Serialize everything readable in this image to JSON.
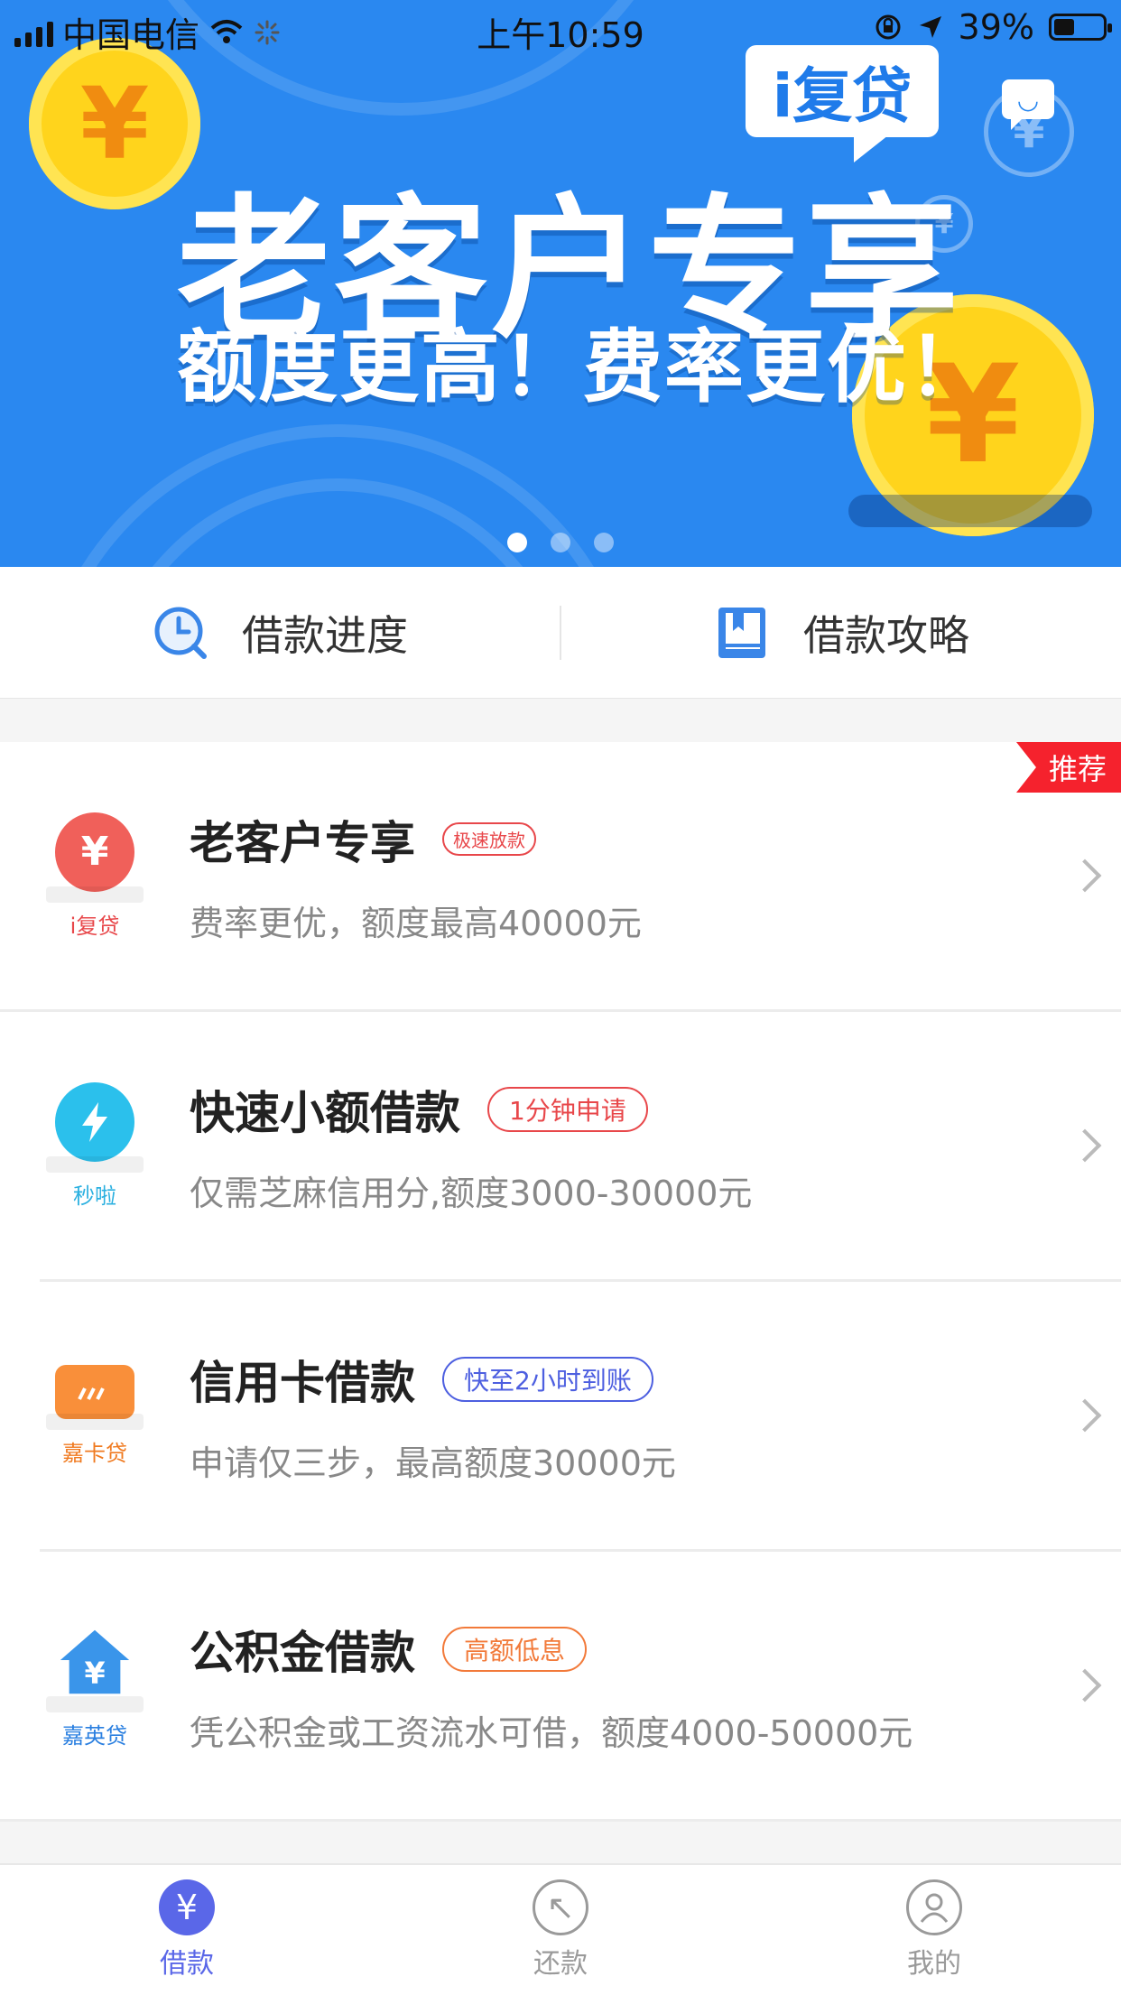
{
  "status_bar": {
    "carrier": "中国电信",
    "time": "上午10:59",
    "battery": "39%"
  },
  "banner": {
    "brand": "i复贷",
    "title": "老客户专享",
    "subtitle": "额度更高！费率更优！",
    "coin_symbol": "¥",
    "page_count": 3,
    "active_page": 1
  },
  "quick_links": [
    {
      "label": "借款进度",
      "icon": "clock-icon"
    },
    {
      "label": "借款攻略",
      "icon": "book-icon"
    }
  ],
  "cards": [
    {
      "brand": "i复贷",
      "title": "老客户专享",
      "tag": "极速放款",
      "subtitle": "费率更优，额度最高40000元",
      "ribbon": "推荐",
      "color": "#f0605a",
      "tag_color": "#e8474a",
      "icon": "yuan-refresh-icon"
    },
    {
      "brand": "秒啦",
      "title": "快速小额借款",
      "tag": "1分钟申请",
      "subtitle": "仅需芝麻信用分,额度3000-30000元",
      "color": "#2bc0ec",
      "tag_color": "#e8474a",
      "icon": "lightning-icon"
    },
    {
      "brand": "嘉卡贷",
      "title": "信用卡借款",
      "tag": "快至2小时到账",
      "subtitle": "申请仅三步，最高额度30000元",
      "color": "#f98f3a",
      "tag_color": "#4d5fe0",
      "icon": "credit-card-icon"
    },
    {
      "brand": "嘉英贷",
      "title": "公积金借款",
      "tag": "高额低息",
      "subtitle": "凭公积金或工资流水可借，额度4000-50000元",
      "color": "#3a95ea",
      "tag_color": "#f27a3a",
      "icon": "house-icon"
    }
  ],
  "tab_bar": [
    {
      "label": "借款",
      "icon": "yuan-icon",
      "active": true
    },
    {
      "label": "还款",
      "icon": "return-icon",
      "active": false
    },
    {
      "label": "我的",
      "icon": "user-icon",
      "active": false
    }
  ],
  "colors": {
    "banner_blue": "#2a88f0",
    "tab_active": "#5a67e8",
    "tab_inactive": "#9a9a9a"
  }
}
